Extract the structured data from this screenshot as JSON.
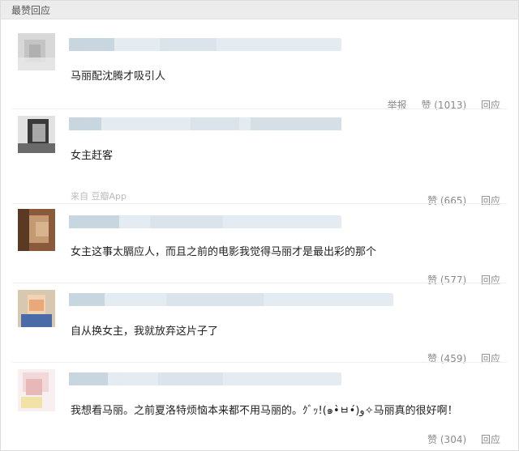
{
  "section": {
    "title": "最赞回应"
  },
  "comments": [
    {
      "text": "马丽配沈腾才吸引人",
      "source": "",
      "report": "举报",
      "like": "赞 (1013)",
      "reply": "回应",
      "avatar_colors": [
        "#d8d8d8",
        "#c4c4c4",
        "#b0b0b0",
        "#e8e8e8"
      ]
    },
    {
      "text": "女主赶客",
      "source": "来自 豆瓣App",
      "report": "",
      "like": "赞 (665)",
      "reply": "回应",
      "avatar_colors": [
        "#e2e2e2",
        "#6a6a6a",
        "#3a3a3a",
        "#a8a8a8"
      ]
    },
    {
      "text": "女主这事太膈应人，而且之前的电影我觉得马丽才是最出彩的那个",
      "source": "",
      "report": "",
      "like": "赞 (577)",
      "reply": "回应",
      "avatar_colors": [
        "#8a5a3a",
        "#c49a72",
        "#5a3a22",
        "#d8b48e"
      ]
    },
    {
      "text": "自从换女主，我就放弃这片子了",
      "source": "",
      "report": "",
      "like": "赞 (459)",
      "reply": "回应",
      "avatar_colors": [
        "#d8c8b0",
        "#e8a878",
        "#4a6aa8",
        "#f2d2b2"
      ]
    },
    {
      "text": "我想看马丽。之前夏洛特烦恼本来都不用马丽的。ｸﾞｯ!(๑•̀ㅂ•́)و✧马丽真的很好啊！",
      "source": "",
      "report": "",
      "like": "赞 (304)",
      "reply": "回应",
      "avatar_colors": [
        "#f2d8d8",
        "#e8b8b8",
        "#f2e2a8",
        "#f8f0f0"
      ]
    }
  ],
  "colors": {
    "meta_bar": "#dde8ee",
    "meta_bar_dark": "#c8d6df",
    "action_text": "#8a8a8a"
  }
}
